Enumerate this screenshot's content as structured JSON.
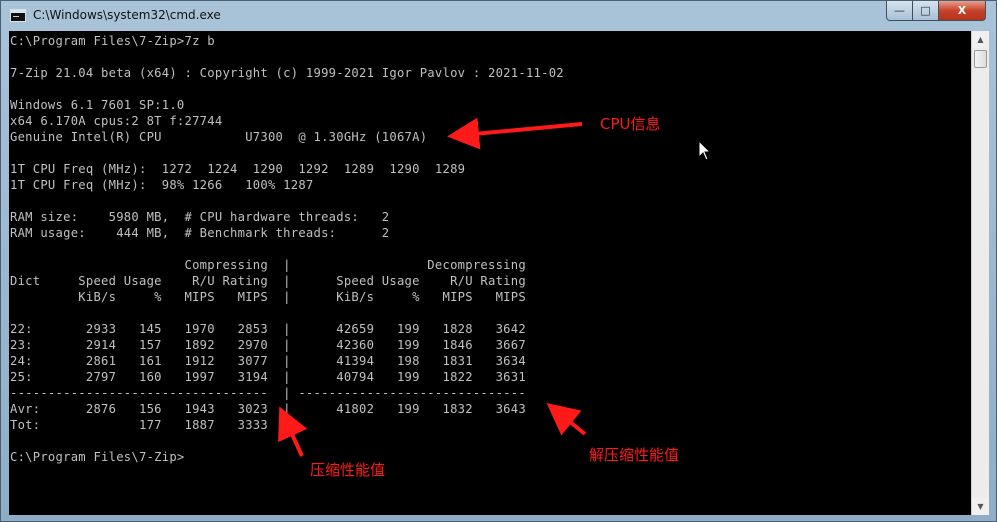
{
  "window": {
    "title": "C:\\Windows\\system32\\cmd.exe",
    "controls": {
      "minimize": "—",
      "maximize": "□",
      "close": "X"
    }
  },
  "console": {
    "lines": [
      "C:\\Program Files\\7-Zip>7z b",
      "",
      "7-Zip 21.04 beta (x64) : Copyright (c) 1999-2021 Igor Pavlov : 2021-11-02",
      "",
      "Windows 6.1 7601 SP:1.0",
      "x64 6.170A cpus:2 8T f:27744",
      "Genuine Intel(R) CPU           U7300  @ 1.30GHz (1067A)",
      "",
      "1T CPU Freq (MHz):  1272  1224  1290  1292  1289  1290  1289",
      "1T CPU Freq (MHz):  98% 1266   100% 1287",
      "",
      "RAM size:    5980 MB,  # CPU hardware threads:   2",
      "RAM usage:    444 MB,  # Benchmark threads:      2",
      "",
      "                       Compressing  |                  Decompressing",
      "Dict     Speed Usage    R/U Rating  |      Speed Usage    R/U Rating",
      "         KiB/s     %   MIPS   MIPS  |      KiB/s     %   MIPS   MIPS",
      "",
      "22:       2933   145   1970   2853  |      42659   199   1828   3642",
      "23:       2914   157   1892   2970  |      42360   199   1846   3667",
      "24:       2861   161   1912   3077  |      41394   198   1831   3634",
      "25:       2797   160   1997   3194  |      40794   199   1822   3631",
      "----------------------------------  | ------------------------------",
      "Avr:      2876   156   1943   3023  |      41802   199   1832   3643",
      "Tot:             177   1887   3333",
      "",
      "C:\\Program Files\\7-Zip>"
    ]
  },
  "annotations": {
    "cpu_info": "CPU信息",
    "compress_rating": "压缩性能值",
    "decompress_rating": "解压缩性能值",
    "color": "#ff1a1a"
  },
  "icons": {
    "window_icon": "cmd-icon",
    "scroll_up": "▲",
    "scroll_down": "▼"
  }
}
